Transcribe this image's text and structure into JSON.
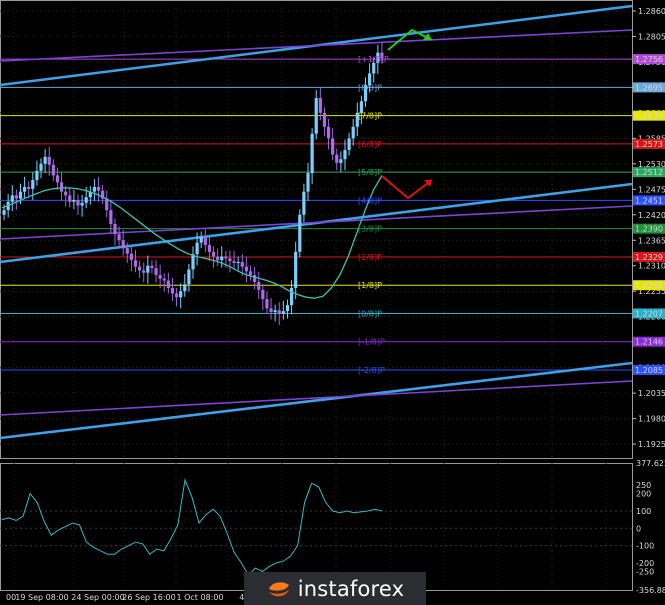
{
  "chart_data": {
    "type": "candlestick",
    "price_ticks": [
      "1.2860",
      "1.2805",
      "1.2750",
      "1.2695",
      "1.2640",
      "1.2585",
      "1.2530",
      "1.2475",
      "1.2420",
      "1.2365",
      "1.2310",
      "1.2255",
      "1.2200",
      "1.2145",
      "1.2090",
      "1.2035",
      "1.1980",
      "1.1925"
    ],
    "price_range": [
      1.1895,
      1.2875
    ],
    "price_badges": [
      {
        "label": "1.2756",
        "value": 1.2756,
        "color": "#b04ad6"
      },
      {
        "label": "1.2695",
        "value": 1.2695,
        "color": "#6aa8d8"
      },
      {
        "label": "1.2634",
        "value": 1.2634,
        "color": "#e6e600"
      },
      {
        "label": "1.2573",
        "value": 1.2573,
        "color": "#d81818"
      },
      {
        "label": "1.2512",
        "value": 1.2512,
        "color": "#2aa860"
      },
      {
        "label": "1.2451",
        "value": 1.2451,
        "color": "#2c50ff"
      },
      {
        "label": "1.2390",
        "value": 1.239,
        "color": "#20903a"
      },
      {
        "label": "1.2329",
        "value": 1.2329,
        "color": "#d81818"
      },
      {
        "label": "1.2268",
        "value": 1.2268,
        "color": "#e6e600"
      },
      {
        "label": "1.2207",
        "value": 1.2207,
        "color": "#2ab0c8"
      },
      {
        "label": "1.2146",
        "value": 1.2146,
        "color": "#8a2ad8"
      },
      {
        "label": "1.2085",
        "value": 1.2085,
        "color": "#2c50ff"
      }
    ],
    "murrey_levels": [
      {
        "label": "[8/8]P",
        "value": 1.2695,
        "color": "#6aa8d8"
      },
      {
        "label": "[7/8]P",
        "value": 1.2634,
        "color": "#e6e600"
      },
      {
        "label": "[6/8]P",
        "value": 1.2573,
        "color": "#d81818"
      },
      {
        "label": "[5/8]P",
        "value": 1.2512,
        "color": "#2aa860"
      },
      {
        "label": "[4/8]P",
        "value": 1.2451,
        "color": "#2c50ff"
      },
      {
        "label": "[3/8]P",
        "value": 1.239,
        "color": "#20903a"
      },
      {
        "label": "[2/8]P",
        "value": 1.2329,
        "color": "#d81818"
      },
      {
        "label": "[1/8]P",
        "value": 1.2268,
        "color": "#e6e600"
      },
      {
        "label": "[0/8]P",
        "value": 1.2207,
        "color": "#2ab0c8"
      },
      {
        "label": "[-1/8]P",
        "value": 1.2146,
        "color": "#8a2ad8"
      },
      {
        "label": "[-2/8]P",
        "value": 1.2085,
        "color": "#2c50ff"
      },
      {
        "label": "[+1/8]P",
        "value": 1.2756,
        "color": "#b04ad6"
      }
    ],
    "time_labels": [
      "00",
      "19 Sep 08:00",
      "24 Sep 00:00",
      "26 Sep 16:00",
      "1 Oct 08:00",
      "4 Oct"
    ],
    "closes": [
      1.243,
      1.2448,
      1.2462,
      1.2455,
      1.247,
      1.248,
      1.2476,
      1.2495,
      1.2515,
      1.253,
      1.2545,
      1.2528,
      1.2505,
      1.249,
      1.247,
      1.2462,
      1.2448,
      1.2452,
      1.244,
      1.2446,
      1.2458,
      1.247,
      1.248,
      1.2472,
      1.2455,
      1.243,
      1.24,
      1.2378,
      1.2365,
      1.2348,
      1.2336,
      1.2322,
      1.2308,
      1.23,
      1.2295,
      1.231,
      1.2305,
      1.229,
      1.2282,
      1.2278,
      1.2262,
      1.225,
      1.2242,
      1.2255,
      1.227,
      1.2302,
      1.2335,
      1.236,
      1.2372,
      1.2355,
      1.234,
      1.233,
      1.2322,
      1.233,
      1.2326,
      1.232,
      1.2316,
      1.2318,
      1.2308,
      1.2298,
      1.229,
      1.2275,
      1.2258,
      1.2238,
      1.2218,
      1.221,
      1.2214,
      1.2206,
      1.2212,
      1.2225,
      1.2262,
      1.234,
      1.242,
      1.247,
      1.251,
      1.2595,
      1.2672,
      1.264,
      1.261,
      1.2585,
      1.255,
      1.2532,
      1.254,
      1.256,
      1.2585,
      1.261,
      1.264,
      1.2665,
      1.27,
      1.2725,
      1.2748,
      1.277,
      1.2758
    ],
    "ma_values": [
      1.2435,
      1.2442,
      1.245,
      1.2458,
      1.2465,
      1.2472,
      1.2476,
      1.2478,
      1.2478,
      1.2476,
      1.2472,
      1.2466,
      1.2458,
      1.2448,
      1.2436,
      1.2422,
      1.2408,
      1.2394,
      1.238,
      1.2368,
      1.2356,
      1.2345,
      1.2336,
      1.233,
      1.2326,
      1.2322,
      1.2316,
      1.2308,
      1.2298,
      1.229,
      1.2285,
      1.228,
      1.2274,
      1.2266,
      1.2256,
      1.2248,
      1.2242,
      1.224,
      1.2244,
      1.2262,
      1.229,
      1.233,
      1.238,
      1.243,
      1.2474,
      1.2505
    ],
    "rsi_ticks": [
      "377.6254",
      "250",
      "200",
      "100",
      "0",
      "-100",
      "-200",
      "-250",
      "-356.8874"
    ],
    "rsi_range": [
      -356.8874,
      377.6254
    ],
    "rsi_values": [
      50,
      60,
      45,
      70,
      200,
      150,
      40,
      -40,
      -10,
      10,
      30,
      20,
      -80,
      -110,
      -130,
      -150,
      -150,
      -120,
      -100,
      -80,
      -90,
      -150,
      -120,
      -130,
      -60,
      20,
      280,
      180,
      30,
      80,
      110,
      70,
      -30,
      -140,
      -200,
      -270,
      -230,
      -250,
      -220,
      -200,
      -190,
      -160,
      -100,
      150,
      260,
      240,
      150,
      100,
      90,
      100,
      90,
      95,
      100,
      110,
      100
    ],
    "annotations": {
      "up_arrow_color": "#22cc22",
      "down_arrow_color": "#e01010"
    }
  },
  "brand": {
    "logo_text": "instaforex",
    "logo_color": "#ffffff",
    "mark_color": "#ff7a1a"
  }
}
